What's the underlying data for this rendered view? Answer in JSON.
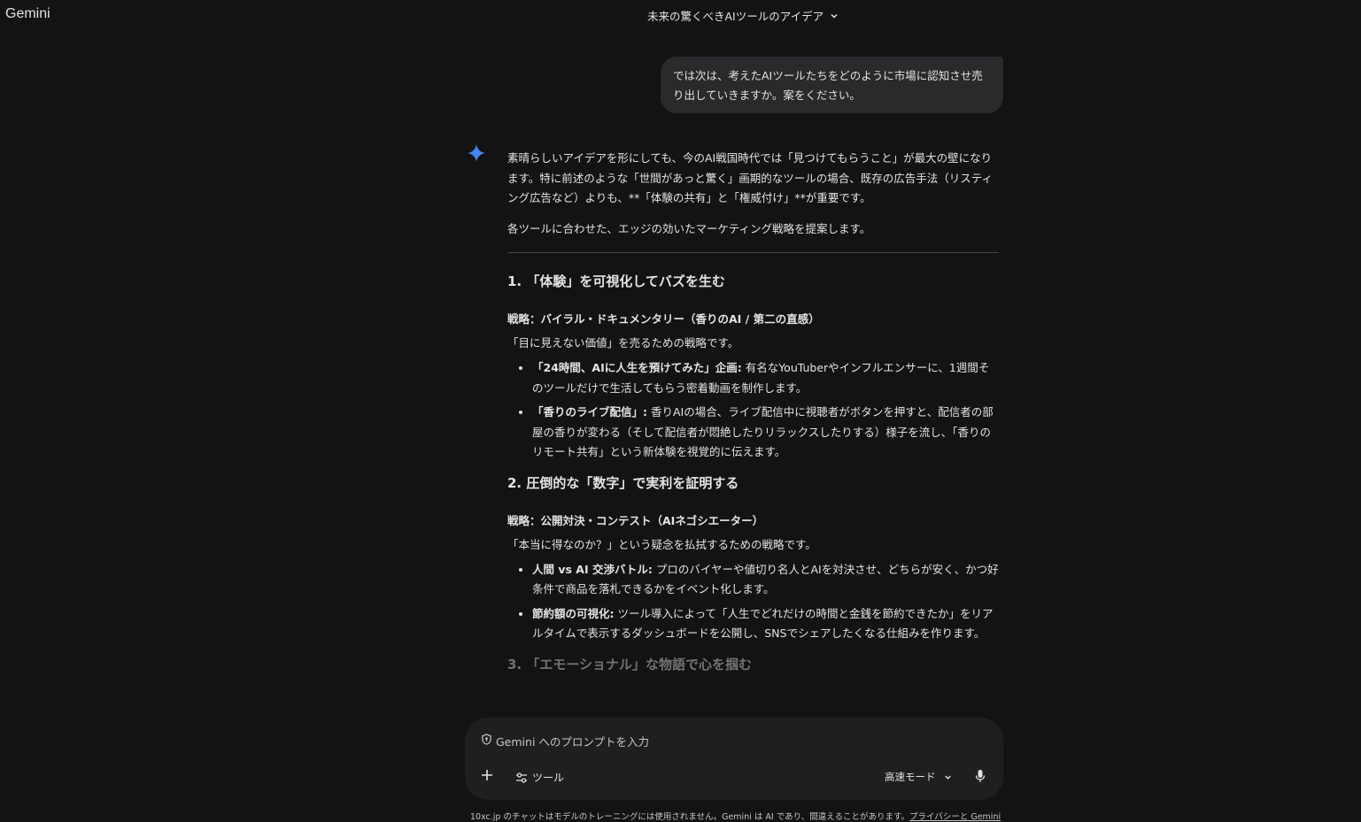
{
  "app": {
    "name": "Gemini"
  },
  "conversation": {
    "title": "未来の驚くべきAIツールのアイデア"
  },
  "user_message": "では次は、考えたAIツールたちをどのように市場に認知させ売り出していきますか。案をください。",
  "response": {
    "intro": "素晴らしいアイデアを形にしても、今のAI戦国時代では「見つけてもらうこと」が最大の壁になります。特に前述のような「世間があっと驚く」画期的なツールの場合、既存の広告手法（リスティング広告など）よりも、**「体験の共有」と「権威付け」**が重要です。",
    "intro2": "各ツールに合わせた、エッジの効いたマーケティング戦略を提案します。",
    "sections": [
      {
        "heading": "1. 「体験」を可視化してバズを生む",
        "strategy": "戦略：バイラル・ドキュメンタリー（香りのAI / 第二の直感）",
        "lead": "「目に見えない価値」を売るための戦略です。",
        "bullets": [
          {
            "title": "「24時間、AIに人生を預けてみた」企画:",
            "text": " 有名なYouTuberやインフルエンサーに、1週間そのツールだけで生活してもらう密着動画を制作します。"
          },
          {
            "title": "「香りのライブ配信」:",
            "text": " 香りAIの場合、ライブ配信中に視聴者がボタンを押すと、配信者の部屋の香りが変わる（そして配信者が悶絶したりリラックスしたりする）様子を流し、「香りのリモート共有」という新体験を視覚的に伝えます。"
          }
        ]
      },
      {
        "heading": "2. 圧倒的な「数字」で実利を証明する",
        "strategy": "戦略：公開対決・コンテスト（AIネゴシエーター）",
        "lead": "「本当に得なのか？」という疑念を払拭するための戦略です。",
        "bullets": [
          {
            "title": "人間 vs AI 交渉バトル:",
            "text": " プロのバイヤーや値切り名人とAIを対決させ、どちらが安く、かつ好条件で商品を落札できるかをイベント化します。"
          },
          {
            "title": "節約額の可視化:",
            "text": " ツール導入によって「人生でどれだけの時間と金銭を節約できたか」をリアルタイムで表示するダッシュボードを公開し、SNSでシェアしたくなる仕組みを作ります。"
          }
        ]
      }
    ],
    "partial_heading": "3. 「エモーショナル」な物語で心を掴む"
  },
  "input": {
    "placeholder": "Gemini へのプロンプトを入力",
    "tools_label": "ツール",
    "mode_label": "高速モード"
  },
  "footer": {
    "text": "10xc.jp のチャットはモデルのトレーニングには使用されません。Gemini は AI であり、間違えることがあります。",
    "link": "プライバシーと Gemini"
  },
  "colors": {
    "background": "#131314",
    "bubble": "#282a2c",
    "input": "#1e1f20",
    "spark": "#4285f4"
  },
  "icons": [
    "chevron-down-icon",
    "gemini-spark-icon",
    "shield-icon",
    "plus-icon",
    "tools-icon",
    "mic-icon"
  ]
}
